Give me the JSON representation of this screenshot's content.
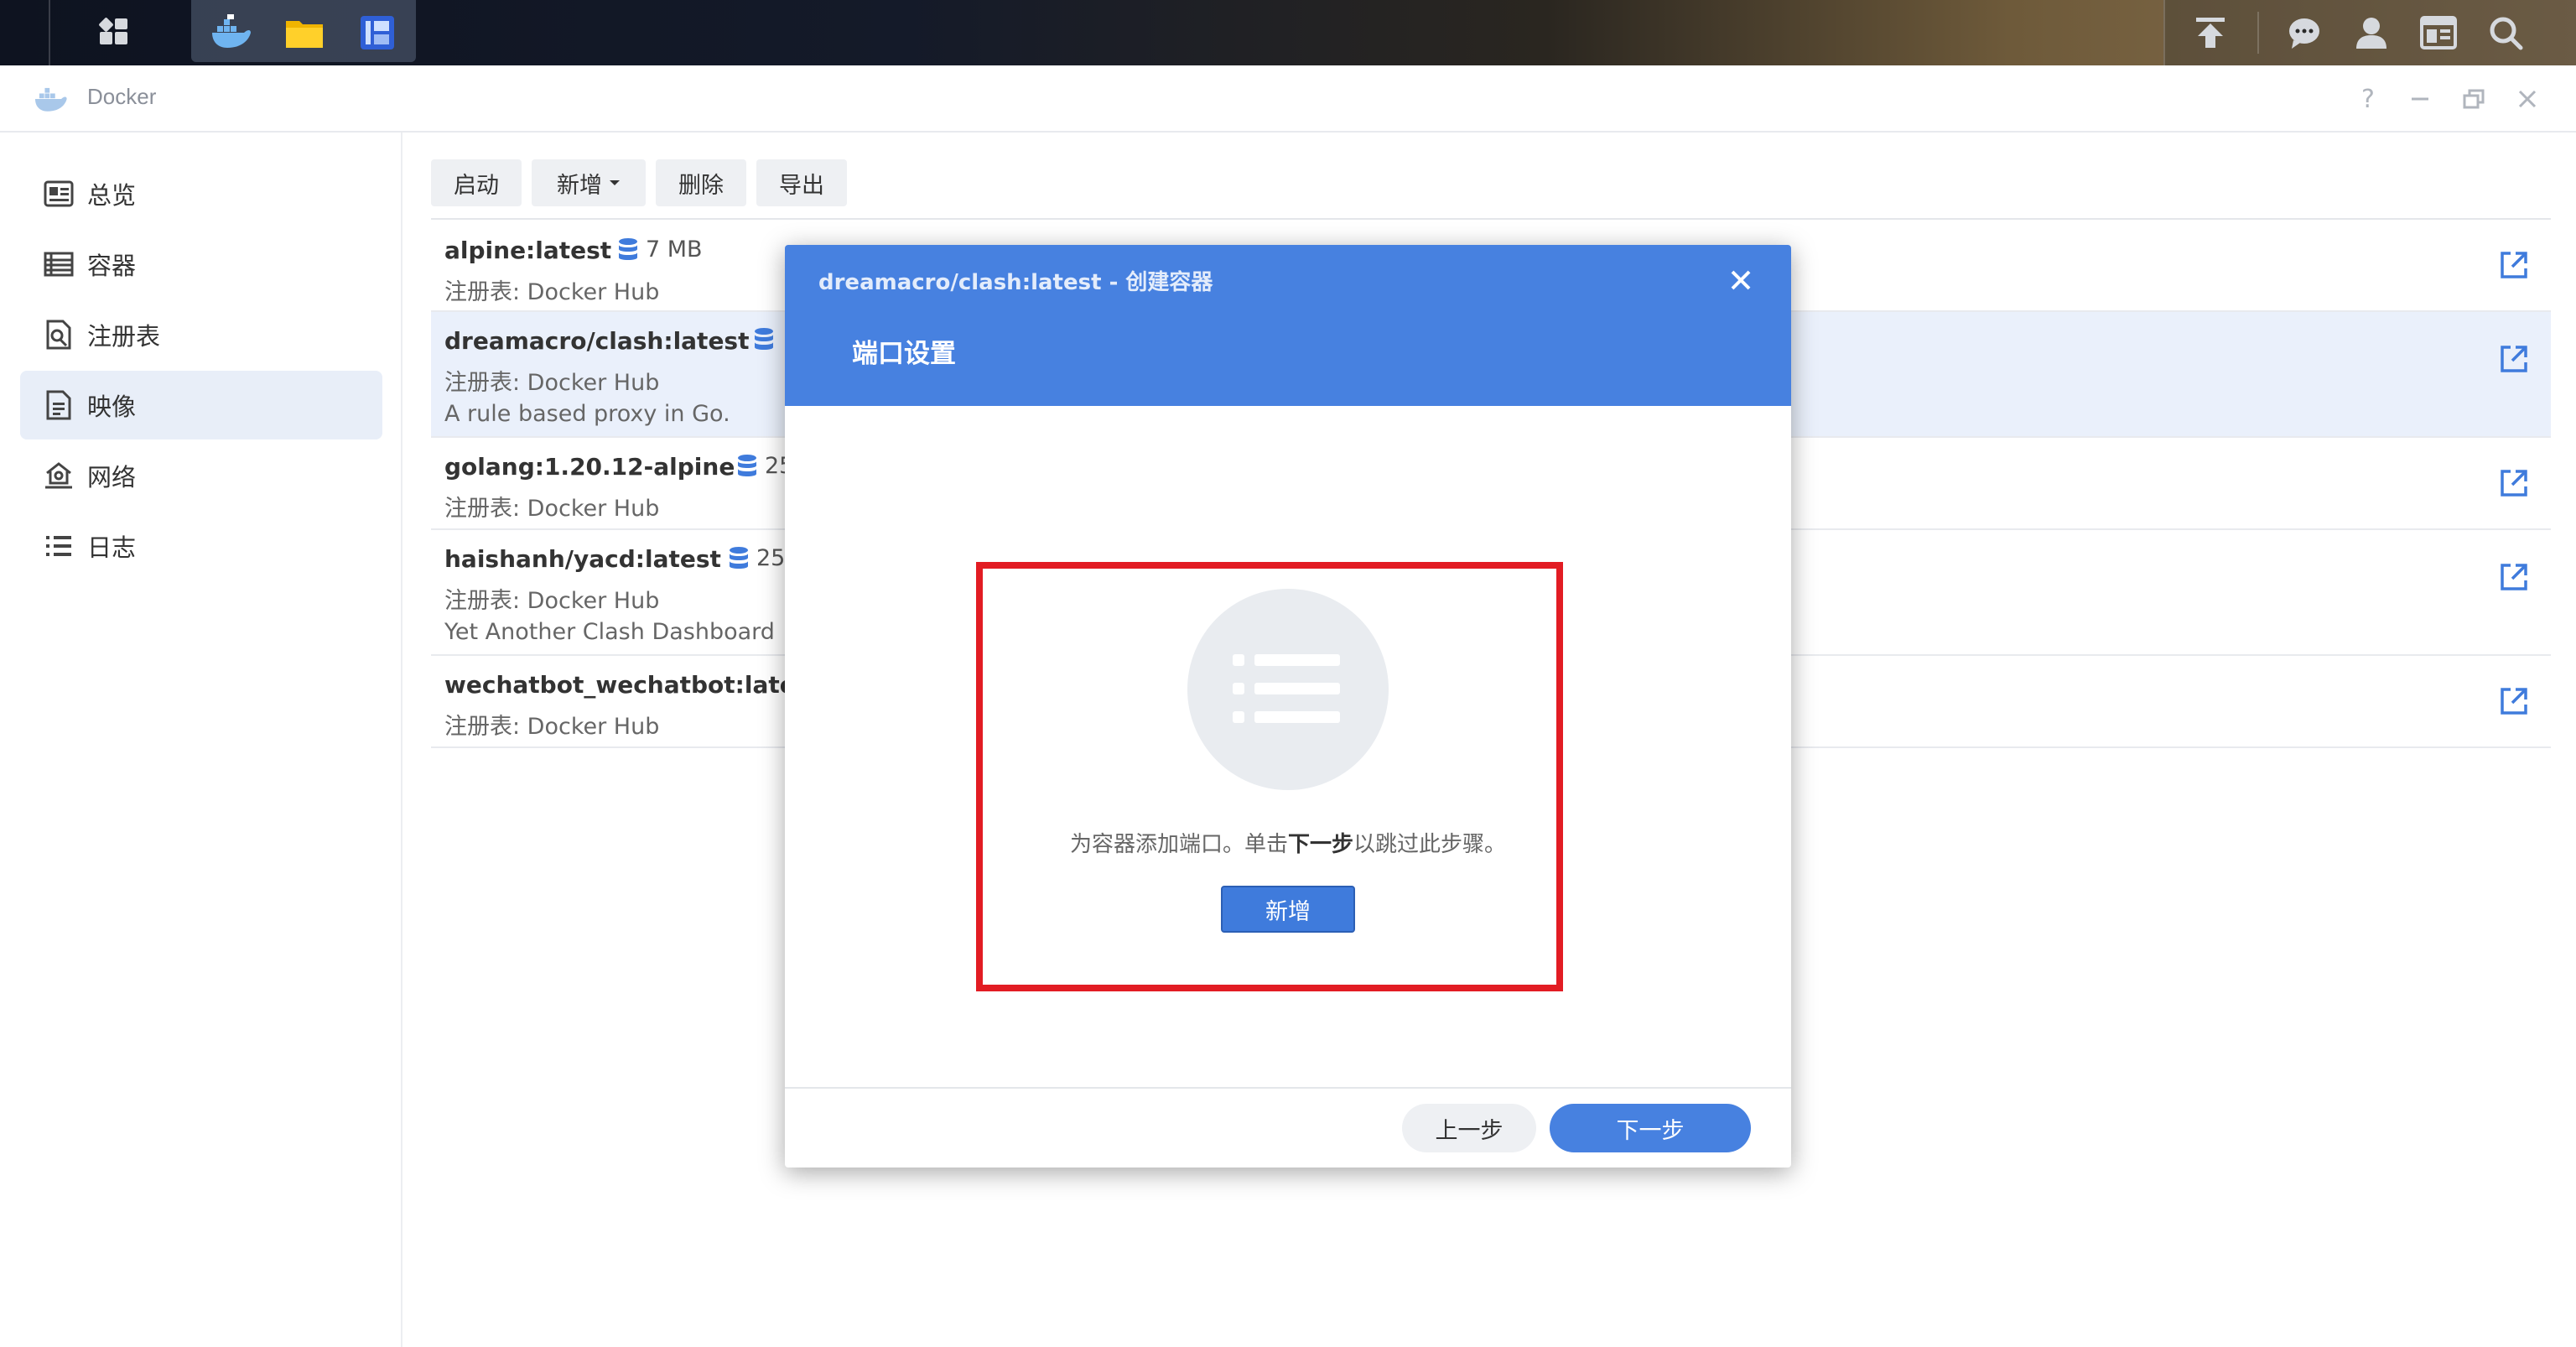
{
  "app": {
    "title": "Docker"
  },
  "taskbar": {
    "left_icons": [
      "grid-icon"
    ],
    "apps": [
      "docker-app-icon",
      "file-station-icon",
      "package-icon"
    ],
    "right_icons": [
      "upload-icon",
      "chat-icon",
      "user-icon",
      "widget-icon",
      "search-icon"
    ]
  },
  "sidebar": {
    "items": [
      {
        "label": "总览",
        "icon": "overview-icon"
      },
      {
        "label": "容器",
        "icon": "container-icon"
      },
      {
        "label": "注册表",
        "icon": "registry-icon"
      },
      {
        "label": "映像",
        "icon": "image-icon",
        "active": true
      },
      {
        "label": "网络",
        "icon": "network-icon"
      },
      {
        "label": "日志",
        "icon": "log-icon"
      }
    ]
  },
  "toolbar": {
    "start": "启动",
    "add": "新增",
    "delete": "删除",
    "export": "导出"
  },
  "images": [
    {
      "name": "alpine:latest",
      "size": "7 MB",
      "registry": "注册表: Docker Hub",
      "desc": ""
    },
    {
      "name": "dreamacro/clash:latest",
      "size": "",
      "registry": "注册表: Docker Hub",
      "desc": "A rule based proxy in Go."
    },
    {
      "name": "golang:1.20.12-alpine",
      "size": "25",
      "registry": "注册表: Docker Hub",
      "desc": ""
    },
    {
      "name": "haishanh/yacd:latest",
      "size": "25",
      "registry": "注册表: Docker Hub",
      "desc": "Yet Another Clash Dashboard"
    },
    {
      "name": "wechatbot_wechatbot:lates",
      "size": "",
      "registry": "注册表: Docker Hub",
      "desc": ""
    }
  ],
  "modal": {
    "subtitle": "dreamacro/clash:latest - 创建容器",
    "title": "端口设置",
    "msg_before": "为容器添加端口。单击",
    "msg_bold": "下一步",
    "msg_after": "以跳过此步骤。",
    "add_label": "新增",
    "prev_label": "上一步",
    "next_label": "下一步"
  },
  "colors": {
    "accent": "#4781e0",
    "highlight": "#e21c23",
    "selected_row": "#eaf0fb"
  }
}
